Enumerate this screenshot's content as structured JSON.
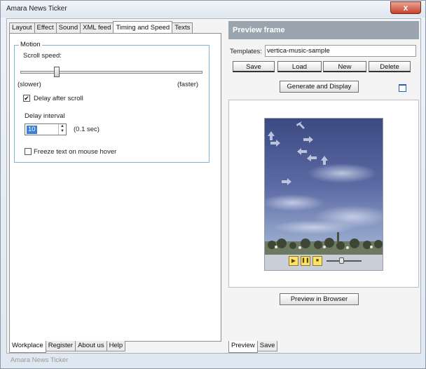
{
  "window": {
    "title": "Amara News Ticker",
    "close_glyph": "x",
    "status_text": "Amara News Ticker"
  },
  "top_tabs": [
    {
      "label": "Layout",
      "active": false
    },
    {
      "label": "Effect",
      "active": false
    },
    {
      "label": "Sound",
      "active": false
    },
    {
      "label": "XML feed",
      "active": false
    },
    {
      "label": "Timing and Speed",
      "active": true
    },
    {
      "label": "Texts",
      "active": false
    }
  ],
  "motion": {
    "group_label": "Motion",
    "scroll_speed_label": "Scroll speed:",
    "slider_min_label": "(slower)",
    "slider_max_label": "(faster)",
    "delay_after_scroll_label": "Delay after scroll",
    "delay_after_scroll_checked": true,
    "delay_interval_label": "Delay interval",
    "delay_interval_value": "10",
    "delay_unit_label": "(0.1 sec)",
    "freeze_label": "Freeze text on mouse hover",
    "freeze_checked": false
  },
  "bottom_left_tabs": [
    {
      "label": "Workplace",
      "active": true
    },
    {
      "label": "Register",
      "active": false
    },
    {
      "label": "About us",
      "active": false
    },
    {
      "label": "Help",
      "active": false
    }
  ],
  "preview": {
    "header": "Preview frame",
    "templates_label": "Templates:",
    "templates_value": "vertica-music-sample",
    "buttons": [
      "Save",
      "Load",
      "New",
      "Delete"
    ],
    "generate_label": "Generate and Display",
    "browser_label": "Preview in Browser"
  },
  "bottom_right_tabs": [
    {
      "label": "Preview",
      "active": true
    },
    {
      "label": "Save",
      "active": false
    }
  ],
  "icons": {
    "close": "close-icon",
    "play": "play-icon",
    "pause": "pause-icon",
    "stop": "stop-icon",
    "checkmark": "✔"
  },
  "colors": {
    "header_bg": "#9aa4ae",
    "close_bg": "#c8412b",
    "selection": "#3b7fd6",
    "group_border": "#7fb2d6"
  }
}
